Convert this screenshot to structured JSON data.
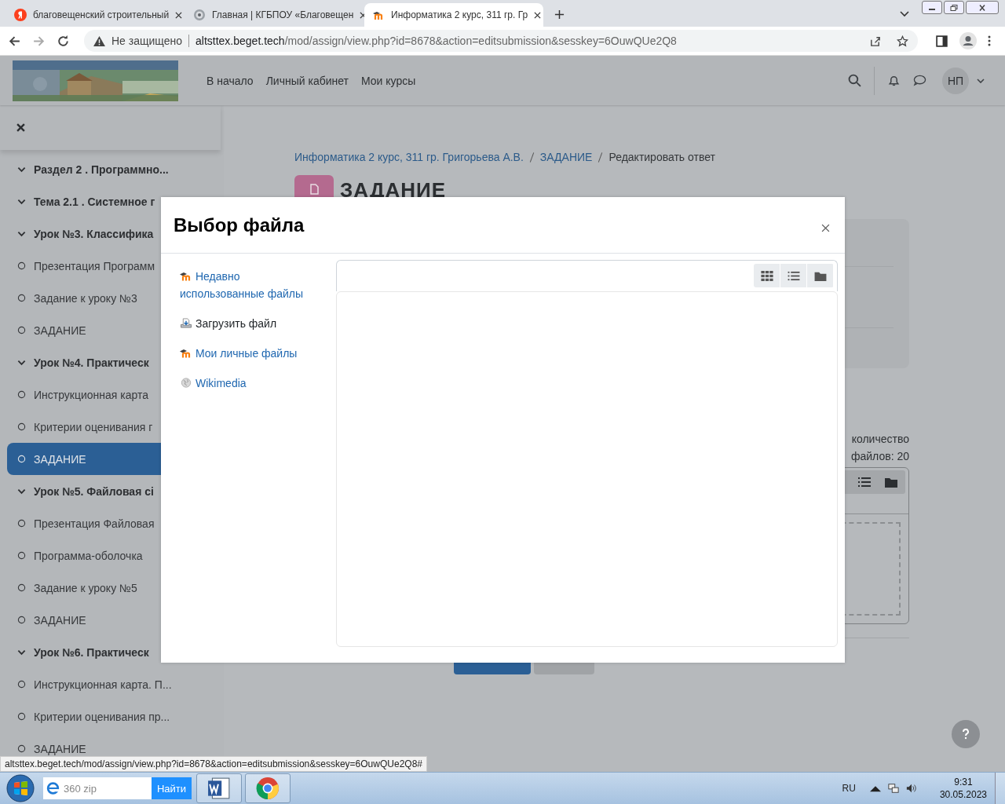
{
  "browser": {
    "tabs": [
      {
        "title": "благовещенский строительный",
        "selected": false
      },
      {
        "title": "Главная | КГБПОУ «Благовещен",
        "selected": false
      },
      {
        "title": "Информатика 2 курс, 311 гр. Гр",
        "selected": true
      }
    ],
    "address": {
      "security": "Не защищено",
      "host": "altsttex.beget.tech",
      "path": "/mod/assign/view.php?id=8678&action=editsubmission&sesskey=6OuwQUe2Q8"
    }
  },
  "site": {
    "nav": [
      "В начало",
      "Личный кабинет",
      "Мои курсы"
    ],
    "user_initials": "НП"
  },
  "sidebar": {
    "items": [
      {
        "kind": "section",
        "text": "Раздел 2 . Программно...",
        "selected": false
      },
      {
        "kind": "section",
        "text": "Тема 2.1 . Системное г",
        "selected": false
      },
      {
        "kind": "section",
        "text": "Урок №3. Классифика",
        "selected": false
      },
      {
        "kind": "activity",
        "text": "Презентация Программ",
        "selected": false
      },
      {
        "kind": "activity",
        "text": "Задание к уроку №3",
        "selected": false
      },
      {
        "kind": "activity",
        "text": "ЗАДАНИЕ",
        "selected": false
      },
      {
        "kind": "section",
        "text": "Урок №4. Практическ",
        "selected": false
      },
      {
        "kind": "activity",
        "text": "Инструкционная карта",
        "selected": false
      },
      {
        "kind": "activity",
        "text": "Критерии оценивания г",
        "selected": false
      },
      {
        "kind": "activity",
        "text": "ЗАДАНИЕ",
        "selected": true
      },
      {
        "kind": "section",
        "text": "Урок №5. Файловая сі",
        "selected": false
      },
      {
        "kind": "activity",
        "text": "Презентация Файловая",
        "selected": false
      },
      {
        "kind": "activity",
        "text": "Программа-оболочка",
        "selected": false
      },
      {
        "kind": "activity",
        "text": "Задание к уроку №5",
        "selected": false
      },
      {
        "kind": "activity",
        "text": "ЗАДАНИЕ",
        "selected": false
      },
      {
        "kind": "section",
        "text": "Урок №6. Практическ",
        "selected": false
      },
      {
        "kind": "activity",
        "text": "Инструкционная карта. П...",
        "selected": false
      },
      {
        "kind": "activity",
        "text": "Критерии оценивания пр...",
        "selected": false
      },
      {
        "kind": "activity",
        "text": "ЗАДАНИЕ",
        "selected": false
      }
    ]
  },
  "page": {
    "breadcrumb": [
      {
        "text": "Информатика 2 курс, 311 гр. Григорьева А.В.",
        "link": true
      },
      {
        "text": "ЗАДАНИЕ",
        "link": true
      },
      {
        "text": "Редактировать ответ",
        "link": false
      }
    ],
    "heading": "ЗАДАНИЕ",
    "limit_lines": [
      "количество",
      "файлов: 20"
    ]
  },
  "modal": {
    "title": "Выбор файла",
    "repositories": [
      {
        "name": "Недавно использованные файлы",
        "selected": false
      },
      {
        "name": "Загрузить файл",
        "selected": true
      },
      {
        "name": "Мои личные файлы",
        "selected": false
      },
      {
        "name": "Wikimedia",
        "selected": false
      }
    ]
  },
  "status_url": "altsttex.beget.tech/mod/assign/view.php?id=8678&action=editsubmission&sesskey=6OuwQUe2Q8#",
  "taskbar": {
    "search_placeholder": "360 zip",
    "search_button": "Найти",
    "language": "RU",
    "time": "9:31",
    "date": "30.05.2023"
  }
}
